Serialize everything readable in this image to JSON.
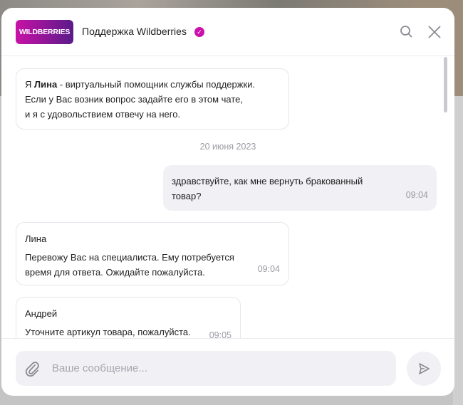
{
  "header": {
    "logo_text": "WILDBERRIES",
    "title": "Поддержка Wildberries"
  },
  "messages": [
    {
      "prefix": "Я ",
      "bold": "Лина",
      "lines": [
        " - виртуальный помощник службы поддержки.",
        "Если у Вас возник вопрос задайте его в этом чате,",
        "и я с удовольствием отвечу на него."
      ]
    },
    {
      "date": "20 июня 2023"
    },
    {
      "text_lines": [
        "здравствуйте, как мне вернуть бракованный",
        "товар?"
      ],
      "time": "09:04"
    },
    {
      "sender": "Лина",
      "text_lines": [
        "Перевожу Вас на специалиста. Ему потребуется",
        "время для ответа. Ожидайте пожалуйста."
      ],
      "time": "09:04"
    },
    {
      "sender": "Андрей",
      "text": "Уточните артикул товара, пожалуйста.",
      "time": "09:05"
    }
  ],
  "composer": {
    "placeholder": "Ваше сообщение..."
  },
  "colors": {
    "brand": "#cb11ab"
  }
}
